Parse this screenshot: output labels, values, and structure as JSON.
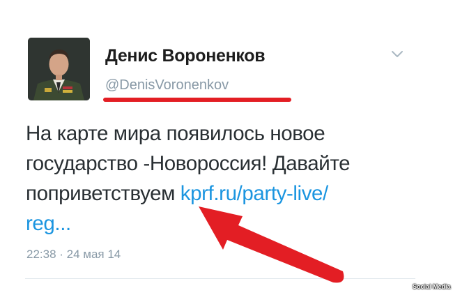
{
  "tweet": {
    "display_name": "Денис Вороненков",
    "handle": "@DenisVoronenkov",
    "text_line1": "На карте мира появилось новое",
    "text_line2": "государство -Новороссия! Давайте",
    "text_line3_plain": "поприветствуем ",
    "link_part1": "kprf.ru/party-live/",
    "link_part2": "reg...",
    "timestamp": "22:38 · 24 мая 14"
  },
  "icons": {
    "avatar": "avatar-photo",
    "menu": "chevron-down-icon"
  },
  "annotations": {
    "underline_color": "#e31e24",
    "arrow_color": "#e31e24"
  },
  "watermark": "Social Media",
  "colors": {
    "link": "#1b95e0",
    "text": "#292f33",
    "secondary": "#8899a6"
  }
}
